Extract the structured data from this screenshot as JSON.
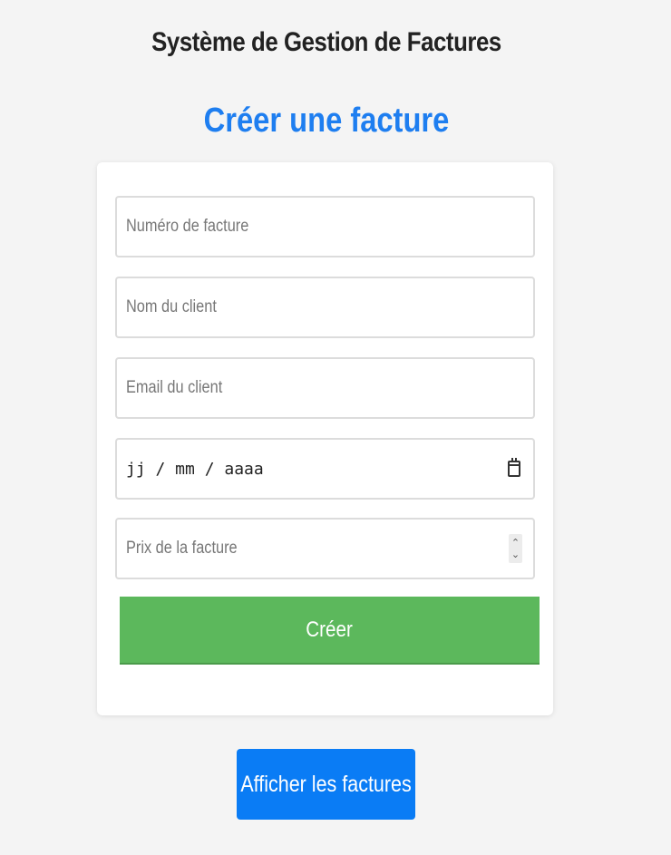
{
  "header": {
    "app_title": "Système de Gestion de Factures",
    "section_title": "Créer une facture"
  },
  "form": {
    "invoice_number": {
      "placeholder": "Numéro de facture",
      "value": ""
    },
    "client_name": {
      "placeholder": "Nom du client",
      "value": ""
    },
    "client_email": {
      "placeholder": "Email du client",
      "value": ""
    },
    "invoice_date": {
      "format": "jj / mm / aaaa",
      "icon": "calendar-icon"
    },
    "invoice_price": {
      "placeholder": "Prix de la facture",
      "value": "",
      "icon": "spinner-icon"
    },
    "submit_label": "Créer"
  },
  "navigation": {
    "show_invoices_label": "Afficher les factures"
  },
  "colors": {
    "accent": "#1e7ef0",
    "submit": "#5cb85c",
    "nav_button": "#0a7cf5",
    "background": "#f4f4f4"
  }
}
